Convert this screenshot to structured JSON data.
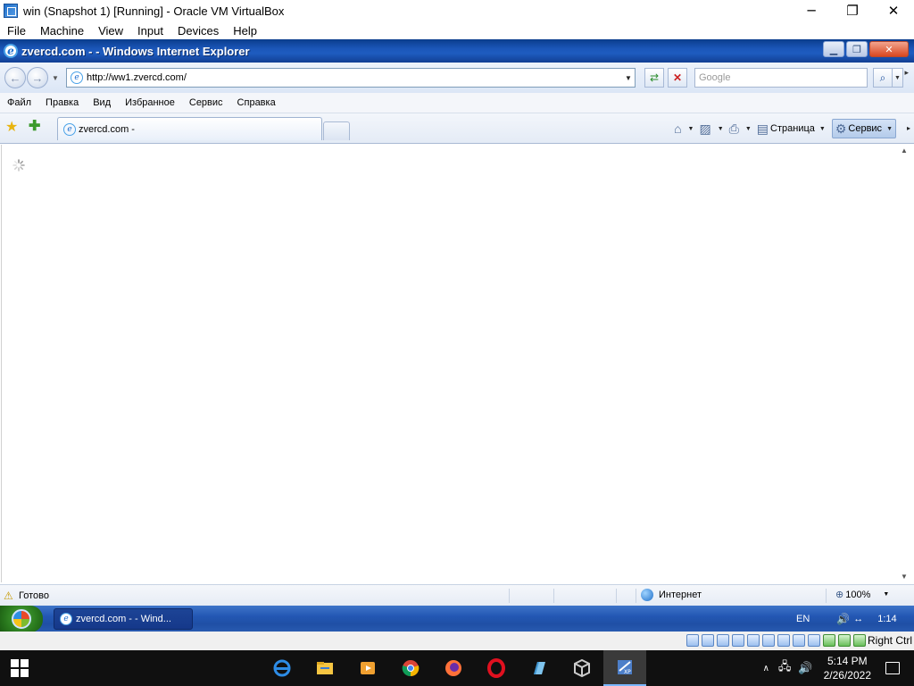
{
  "host": {
    "title": "win (Snapshot 1) [Running] - Oracle VM VirtualBox",
    "controls": {
      "minimize": "─",
      "maximize": "❐",
      "close": "✕"
    },
    "menu": [
      "File",
      "Machine",
      "View",
      "Input",
      "Devices",
      "Help"
    ]
  },
  "ie": {
    "title": "zvercd.com -  - Windows Internet Explorer",
    "win_btns": {
      "min": "▁",
      "max": "❐",
      "close": "✕"
    },
    "address": "http://ww1.zvercd.com/",
    "search_placeholder": "Google",
    "menu": [
      "Файл",
      "Правка",
      "Вид",
      "Избранное",
      "Сервис",
      "Справка"
    ],
    "tab_label": "zvercd.com -",
    "commands": {
      "page": "Страница",
      "service": "Сервис"
    },
    "status": {
      "text": "Готово",
      "zone": "Интернет",
      "zoom": "100%"
    }
  },
  "xp_taskbar": {
    "task_label": "zvercd.com -  - Wind...",
    "lang": "EN",
    "time": "1:14"
  },
  "vbox_status": {
    "host_key": "Right Ctrl"
  },
  "win_taskbar": {
    "time": "5:14 PM",
    "date": "2/26/2022",
    "pinned": [
      "ie-icon",
      "file-explorer-icon",
      "media-player-icon",
      "chrome-icon",
      "firefox-icon",
      "opera-icon",
      "notepad-icon",
      "virtualbox-icon",
      "vm-xp-icon"
    ]
  },
  "colors": {
    "xp_blue": "#2357b3",
    "win10_taskbar": "#101010",
    "ie_chrome": "#dbe6f6"
  }
}
